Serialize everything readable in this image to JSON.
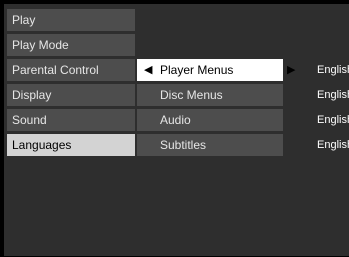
{
  "menu": {
    "categories": [
      {
        "label": "Play"
      },
      {
        "label": "Play Mode"
      },
      {
        "label": "Parental Control"
      },
      {
        "label": "Display"
      },
      {
        "label": "Sound"
      },
      {
        "label": "Languages",
        "active": true
      }
    ],
    "submenu": [
      {
        "label": "Player Menus",
        "selected": true
      },
      {
        "label": "Disc Menus"
      },
      {
        "label": "Audio"
      },
      {
        "label": "Subtitles"
      }
    ],
    "values": [
      {
        "label": "English"
      },
      {
        "label": "English"
      },
      {
        "label": "English"
      },
      {
        "label": "English"
      }
    ],
    "arrows": {
      "left": "◀",
      "right": "▶"
    }
  },
  "colors": {
    "background": "#000000",
    "panel": "#2e2e2e",
    "item": "#4d4d4d",
    "active_item": "#d3d3d3",
    "selected_item": "#ffffff"
  }
}
